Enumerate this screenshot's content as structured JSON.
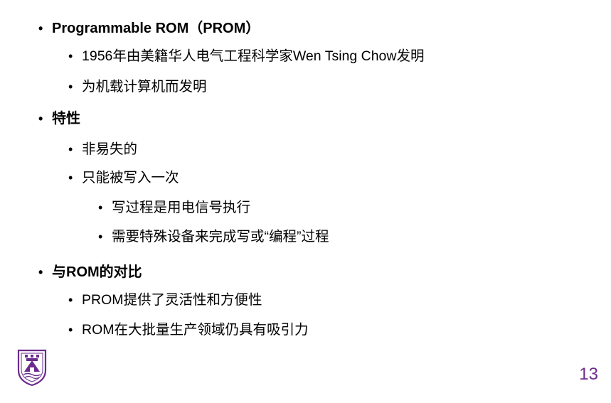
{
  "bullets": {
    "prom_title": "Programmable ROM（PROM）",
    "prom_sub1": "1956年由美籍华人电气工程科学家Wen Tsing Chow发明",
    "prom_sub2": "为机载计算机而发明",
    "features_title": "特性",
    "features_sub1": "非易失的",
    "features_sub2": "只能被写入一次",
    "features_sub2_a": "写过程是用电信号执行",
    "features_sub2_b": "需要特殊设备来完成写或“编程”过程",
    "compare_title": "与ROM的对比",
    "compare_sub1": "PROM提供了灵活性和方便性",
    "compare_sub2": "ROM在大批量生产领域仍具有吸引力"
  },
  "bullet_symbol": "•",
  "page_number": "13",
  "colors": {
    "text": "#000000",
    "accent": "#6b2c8e"
  },
  "logo": {
    "icon": "university-crest-icon"
  }
}
